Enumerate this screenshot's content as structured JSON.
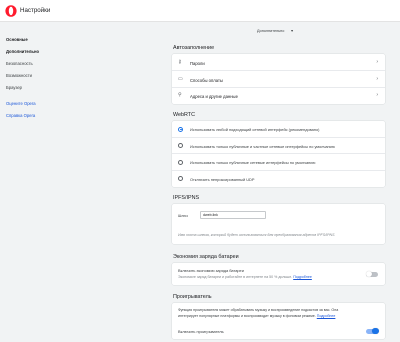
{
  "app": {
    "title": "Настройки"
  },
  "sidebar": {
    "items": [
      {
        "label": "Основные"
      },
      {
        "label": "Дополнительно"
      },
      {
        "label": "Безопасность"
      },
      {
        "label": "Возможности"
      },
      {
        "label": "Браузер"
      }
    ],
    "links": [
      {
        "label": "Оцените Opera"
      },
      {
        "label": "Справка Opera"
      }
    ]
  },
  "dropdown": {
    "label": "Дополнительно"
  },
  "autofill": {
    "title": "Автозаполнение",
    "items": [
      {
        "label": "Пароли",
        "icon": "key-icon"
      },
      {
        "label": "Способы оплаты",
        "icon": "credit-card-icon"
      },
      {
        "label": "Адреса и другие данные",
        "icon": "location-pin-icon"
      }
    ]
  },
  "webrtc": {
    "title": "WebRTC",
    "options": [
      {
        "label": "Использовать любой подходящий сетевой интерфейс (рекомендовано)",
        "selected": true
      },
      {
        "label": "Использовать только публичные и частные сетевые интерфейсы по умолчанию",
        "selected": false
      },
      {
        "label": "Использовать только публичные сетевые интерфейсы по умолчанию",
        "selected": false
      },
      {
        "label": "Отключить непроксированный UDP",
        "selected": false
      }
    ]
  },
  "ipfs": {
    "title": "IPFS/IPNS",
    "gateway_label": "Шлюз",
    "gateway_value": "dweb.link",
    "hint": "Имя хоста шлюза, который будет использоваться для преобразования адресов IPFS/IPNS"
  },
  "battery": {
    "title": "Экономия заряда батареи",
    "toggle_label": "Включить экономию заряда батареи",
    "description": "Экономьте заряд батареи и работайте в интернете на 50 % дольше.",
    "link": "Подробнее",
    "enabled": false
  },
  "player": {
    "title": "Проигрыватель",
    "description_line1": "Функция проигрывателя может обрабатывать музыку и воспроизведение подкастов за вас. Она",
    "description_line2": "интегрирует популярные платформы и воспроизводит музыку в фоновом режиме.",
    "link": "Подробнее",
    "toggle_label": "Включить проигрыватель",
    "enabled": true
  },
  "colors": {
    "accent": "#1a73e8",
    "brand": "#ff1b2d",
    "link": "#1a56d8"
  }
}
